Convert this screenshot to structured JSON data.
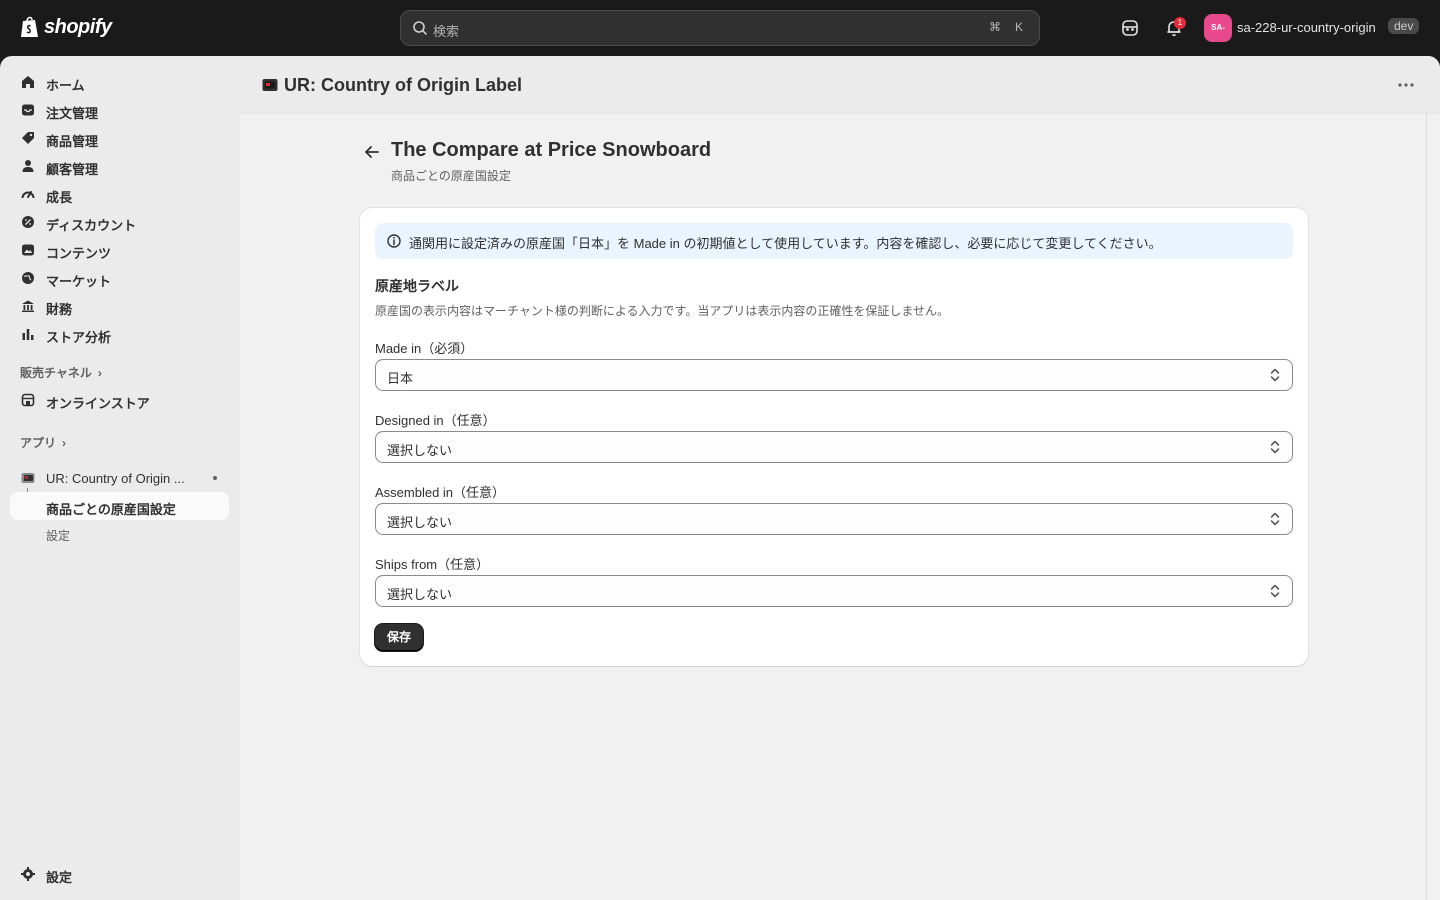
{
  "topbar": {
    "logo_text": "shopify",
    "search_placeholder": "検索",
    "kbd_cmd": "⌘",
    "kbd_k": "K",
    "notification_count": "1",
    "avatar_initials": "SA-",
    "store_name": "sa-228-ur-country-origin",
    "dev_badge": "dev"
  },
  "sidebar": {
    "items": [
      {
        "label": "ホーム",
        "icon": "home-icon"
      },
      {
        "label": "注文管理",
        "icon": "inbox-icon"
      },
      {
        "label": "商品管理",
        "icon": "tag-icon"
      },
      {
        "label": "顧客管理",
        "icon": "person-icon"
      },
      {
        "label": "成長",
        "icon": "gauge-icon"
      },
      {
        "label": "ディスカウント",
        "icon": "discount-icon"
      },
      {
        "label": "コンテンツ",
        "icon": "content-icon"
      },
      {
        "label": "マーケット",
        "icon": "globe-icon"
      },
      {
        "label": "財務",
        "icon": "bank-icon"
      },
      {
        "label": "ストア分析",
        "icon": "chart-bar-icon"
      }
    ],
    "sales_channels_heading": "販売チャネル",
    "online_store": "オンラインストア",
    "apps_heading": "アプリ",
    "app_name": "UR: Country of Origin ...",
    "app_sub_active": "商品ごとの原産国設定",
    "app_sub_settings": "設定",
    "settings": "設定"
  },
  "app_header": {
    "title": "UR: Country of Origin Label"
  },
  "page": {
    "title": "The Compare at Price Snowboard",
    "subtitle": "商品ごとの原産国設定"
  },
  "card": {
    "banner": "通関用に設定済みの原産国「日本」を Made in の初期値として使用しています。内容を確認し、必要に応じて変更してください。",
    "section_title": "原産地ラベル",
    "section_desc": "原産国の表示内容はマーチャント様の判断による入力です。当アプリは表示内容の正確性を保証しません。",
    "fields": [
      {
        "label": "Made in（必須）",
        "value": "日本"
      },
      {
        "label": "Designed in（任意）",
        "value": "選択しない"
      },
      {
        "label": "Assembled in（任意）",
        "value": "選択しない"
      },
      {
        "label": "Ships from（任意）",
        "value": "選択しない"
      }
    ],
    "save_label": "保存"
  },
  "colors": {
    "topbar": "#1a1a1a",
    "sidebar": "#ebebeb",
    "main": "#f1f1f1",
    "banner": "#eaf4ff",
    "primary_button": "#303030",
    "avatar": "#e8498c",
    "badge": "#e22c38"
  }
}
